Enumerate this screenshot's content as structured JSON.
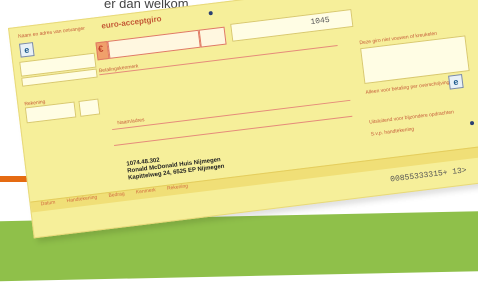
{
  "intro_text": "er dan welkom.",
  "slip": {
    "title": "euro-acceptgiro",
    "top_left_label": "Naam en adres van ontvanger",
    "amount_value": "1045",
    "euro_symbol": "€",
    "left_logo": "e",
    "right_logo": "e",
    "reference_label": "Betalingskenmerk",
    "account_label": "Rekening",
    "payer_label": "Naam/adres",
    "account_number": "1074.48.302",
    "payee_name": "Ronald McDonald Huis Nijmegen",
    "payee_address": "Kapittelweg 24, 6525 EP Nijmegen",
    "right_label_1": "Deze giro niet vouwen of kreukelen",
    "right_label_2": "Alleen voor betaling per overschrijving",
    "right_label_3": "Uitsluitend voor bijzondere opdrachten",
    "right_label_4": "S.v.p. handtekening",
    "bottom_strip_items": [
      "Datum",
      "Handtekening",
      "Bedrag",
      "Kenmerk",
      "Rekening"
    ],
    "scan_line": "00855333315+ 13>"
  }
}
